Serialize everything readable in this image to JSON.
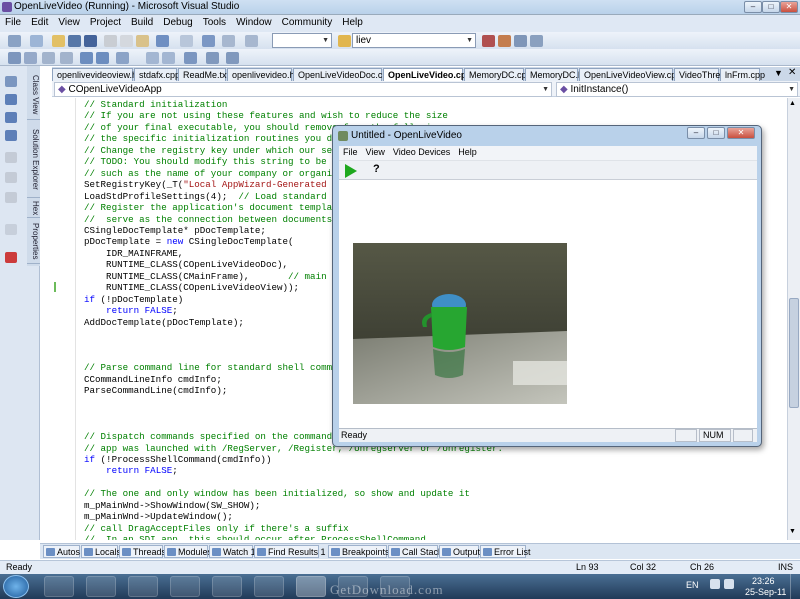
{
  "window": {
    "title": "OpenLiveVideo (Running) - Microsoft Visual Studio"
  },
  "menu": [
    "File",
    "Edit",
    "View",
    "Project",
    "Build",
    "Debug",
    "Tools",
    "Window",
    "Community",
    "Help"
  ],
  "toolbar": {
    "config_value": "",
    "find_value": "liev"
  },
  "left_tabs": [
    "Class View",
    "Solution Explorer",
    "Hex",
    "Properties"
  ],
  "doc_tabs": [
    "openlivevideoview.h",
    "stdafx.cpp",
    "ReadMe.txt",
    "openlivevideo.h",
    "OpenLiveVideoDoc.cpp",
    "OpenLiveVideo.cpp",
    "MemoryDC.cpp",
    "MemoryDC.h",
    "OpenLiveVideoView.cpp",
    "VideoThre",
    "lnFrm.cpp"
  ],
  "scope": {
    "class": "COpenLiveVideoApp",
    "member": "InitInstance()"
  },
  "code_lines": [
    "// Standard initialization",
    "// If you are not using these features and wish to reduce the size",
    "// of your final executable, you should remove from the following",
    "// the specific initialization routines you do not need",
    "// Change the registry key under which our settings are stored",
    "// TODO: You should modify this string to be something appropriate",
    "// such as the name of your company or organization",
    "SetRegistryKey(_T(\"Local AppWizard-Generated Applications\"));",
    "LoadStdProfileSettings(4);  // Load standard INI file options (including MRU)",
    "// Register the application's document templates.  Document templates",
    "//  serve as the connection between documents, frame windows and views",
    "CSingleDocTemplate* pDocTemplate;",
    "pDocTemplate = new CSingleDocTemplate(",
    "    IDR_MAINFRAME,",
    "    RUNTIME_CLASS(COpenLiveVideoDoc),",
    "    RUNTIME_CLASS(CMainFrame),       // main SDI frame window",
    "    RUNTIME_CLASS(COpenLiveVideoView));",
    "if (!pDocTemplate)",
    "    return FALSE;",
    "AddDocTemplate(pDocTemplate);",
    "",
    "",
    "",
    "// Parse command line for standard shell commands, DDE, file open",
    "CCommandLineInfo cmdInfo;",
    "ParseCommandLine(cmdInfo);",
    "",
    "",
    "",
    "// Dispatch commands specified on the command line.  Will return FALSE if",
    "// app was launched with /RegServer, /Register, /Unregserver or /Unregister.",
    "if (!ProcessShellCommand(cmdInfo))",
    "    return FALSE;",
    "",
    "// The one and only window has been initialized, so show and update it",
    "m_pMainWnd->ShowWindow(SW_SHOW);",
    "m_pMainWnd->UpdateWindow();",
    "// call DragAcceptFiles only if there's a suffix",
    "//  In an SDI app, this should occur after ProcessShellCommand"
  ],
  "bottom_tabs": [
    "Autos",
    "Locals",
    "Threads",
    "Modules",
    "Watch 1",
    "Find Results 1",
    "Breakpoints",
    "Call Stack",
    "Output",
    "Error List"
  ],
  "status": {
    "left": "Ready",
    "ln": "Ln 93",
    "col": "Col 32",
    "ch": "Ch 26",
    "ins": "INS"
  },
  "olv": {
    "title": "Untitled - OpenLiveVideo",
    "menu": [
      "File",
      "View",
      "Video Devices",
      "Help"
    ],
    "status_left": "Ready",
    "status_num": "NUM"
  },
  "taskbar": {
    "lang": "EN",
    "time": "23:26",
    "date": "25-Sep-11",
    "watermark": "GetDownload.com"
  }
}
